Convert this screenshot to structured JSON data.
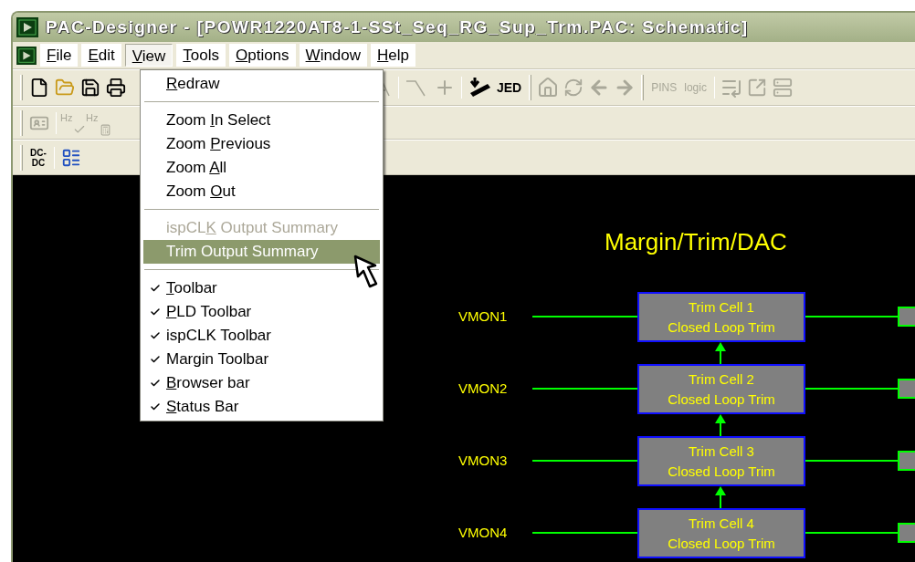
{
  "window": {
    "title": "PAC-Designer - [POWR1220AT8-1-SSt_Seq_RG_Sup_Trm.PAC: Schematic]"
  },
  "menu_bar": [
    {
      "key": "F",
      "post": "ile",
      "selected": false
    },
    {
      "key": "E",
      "post": "dit",
      "selected": false
    },
    {
      "key": "V",
      "post": "iew",
      "selected": true
    },
    {
      "key": "T",
      "post": "ools",
      "selected": false
    },
    {
      "key": "O",
      "post": "ptions",
      "selected": false
    },
    {
      "key": "W",
      "post": "indow",
      "selected": false
    },
    {
      "key": "H",
      "post": "elp",
      "selected": false
    }
  ],
  "toolbar_1": {
    "jed_label": "JED",
    "pins_label": "PINS",
    "logic_label": "logic"
  },
  "toolbar_2": {
    "hz_labels": [
      "Hz",
      "Hz"
    ]
  },
  "toolbar_3": {
    "dc_dc_label": [
      "DC-",
      "DC"
    ]
  },
  "view_menu": {
    "items": [
      {
        "kind": "item",
        "key": "R",
        "post": "edraw",
        "checked": false,
        "disabled": false,
        "selected": false
      },
      {
        "kind": "separator"
      },
      {
        "kind": "item",
        "pre": "Zoom ",
        "key": "I",
        "post": "n Select",
        "checked": false,
        "disabled": false,
        "selected": false
      },
      {
        "kind": "item",
        "pre": "Zoom ",
        "key": "P",
        "post": "revious",
        "checked": false,
        "disabled": false,
        "selected": false
      },
      {
        "kind": "item",
        "pre": "Zoom ",
        "key": "A",
        "post": "ll",
        "checked": false,
        "disabled": false,
        "selected": false
      },
      {
        "kind": "item",
        "pre": "Zoom ",
        "key": "O",
        "post": "ut",
        "checked": false,
        "disabled": false,
        "selected": false
      },
      {
        "kind": "separator"
      },
      {
        "kind": "item",
        "pre": "ispCL",
        "key": "K",
        "post": " Output Summary",
        "checked": false,
        "disabled": true,
        "selected": false
      },
      {
        "kind": "item",
        "pre": "Trim Output Summary",
        "checked": false,
        "disabled": false,
        "selected": true
      },
      {
        "kind": "separator"
      },
      {
        "kind": "item",
        "key": "T",
        "post": "oolbar",
        "checked": true,
        "disabled": false,
        "selected": false
      },
      {
        "kind": "item",
        "key": "P",
        "post": "LD Toolbar",
        "checked": true,
        "disabled": false,
        "selected": false
      },
      {
        "kind": "item",
        "pre": "ispCLK Toolbar",
        "checked": true,
        "disabled": false,
        "selected": false
      },
      {
        "kind": "item",
        "pre": "Margin Toolbar",
        "checked": true,
        "disabled": false,
        "selected": false
      },
      {
        "kind": "item",
        "key": "B",
        "post": "rowser bar",
        "checked": true,
        "disabled": false,
        "selected": false
      },
      {
        "kind": "item",
        "key": "S",
        "post": "tatus Bar",
        "checked": true,
        "disabled": false,
        "selected": false
      }
    ]
  },
  "schematic": {
    "title": "Margin/Trim/DAC",
    "cells": [
      {
        "input": "VMON1",
        "name": "Trim Cell 1",
        "mode": "Closed Loop Trim"
      },
      {
        "input": "VMON2",
        "name": "Trim Cell 2",
        "mode": "Closed Loop Trim"
      },
      {
        "input": "VMON3",
        "name": "Trim Cell 3",
        "mode": "Closed Loop Trim"
      },
      {
        "input": "VMON4",
        "name": "Trim Cell 4",
        "mode": "Closed Loop Trim"
      }
    ]
  }
}
